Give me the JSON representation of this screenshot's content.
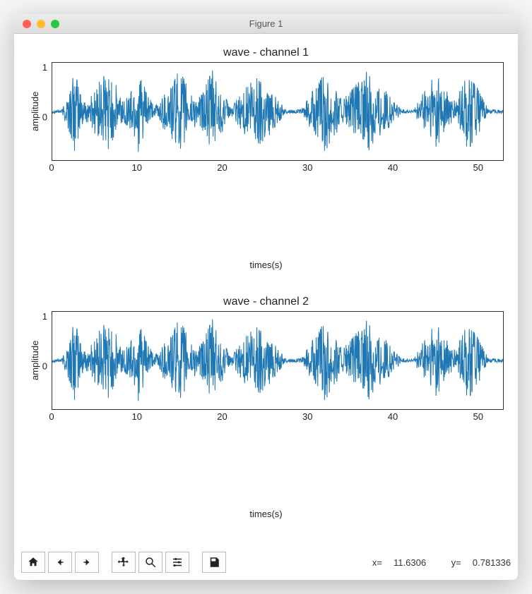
{
  "window": {
    "title": "Figure 1"
  },
  "toolbar": {
    "coord_x_label": "x=",
    "coord_y_label": "y=",
    "coord_x": "11.6306",
    "coord_y": "0.781336"
  },
  "chart_data": [
    {
      "type": "line",
      "title": "wave - channel 1",
      "xlabel": "times(s)",
      "ylabel": "amplitude",
      "xlim": [
        0,
        53
      ],
      "ylim": [
        -1,
        1
      ],
      "xticks": [
        0,
        10,
        20,
        30,
        40,
        50
      ],
      "yticks": [
        1,
        0
      ],
      "description": "Audio waveform, amplitude oscillating roughly between -0.8 and 1.0 across 0–53 seconds"
    },
    {
      "type": "line",
      "title": "wave - channel 2",
      "xlabel": "times(s)",
      "ylabel": "amplitude",
      "xlim": [
        0,
        53
      ],
      "ylim": [
        -1,
        1
      ],
      "xticks": [
        0,
        10,
        20,
        30,
        40,
        50
      ],
      "yticks": [
        1,
        0
      ],
      "description": "Audio waveform (second channel), visually similar to channel 1"
    }
  ]
}
